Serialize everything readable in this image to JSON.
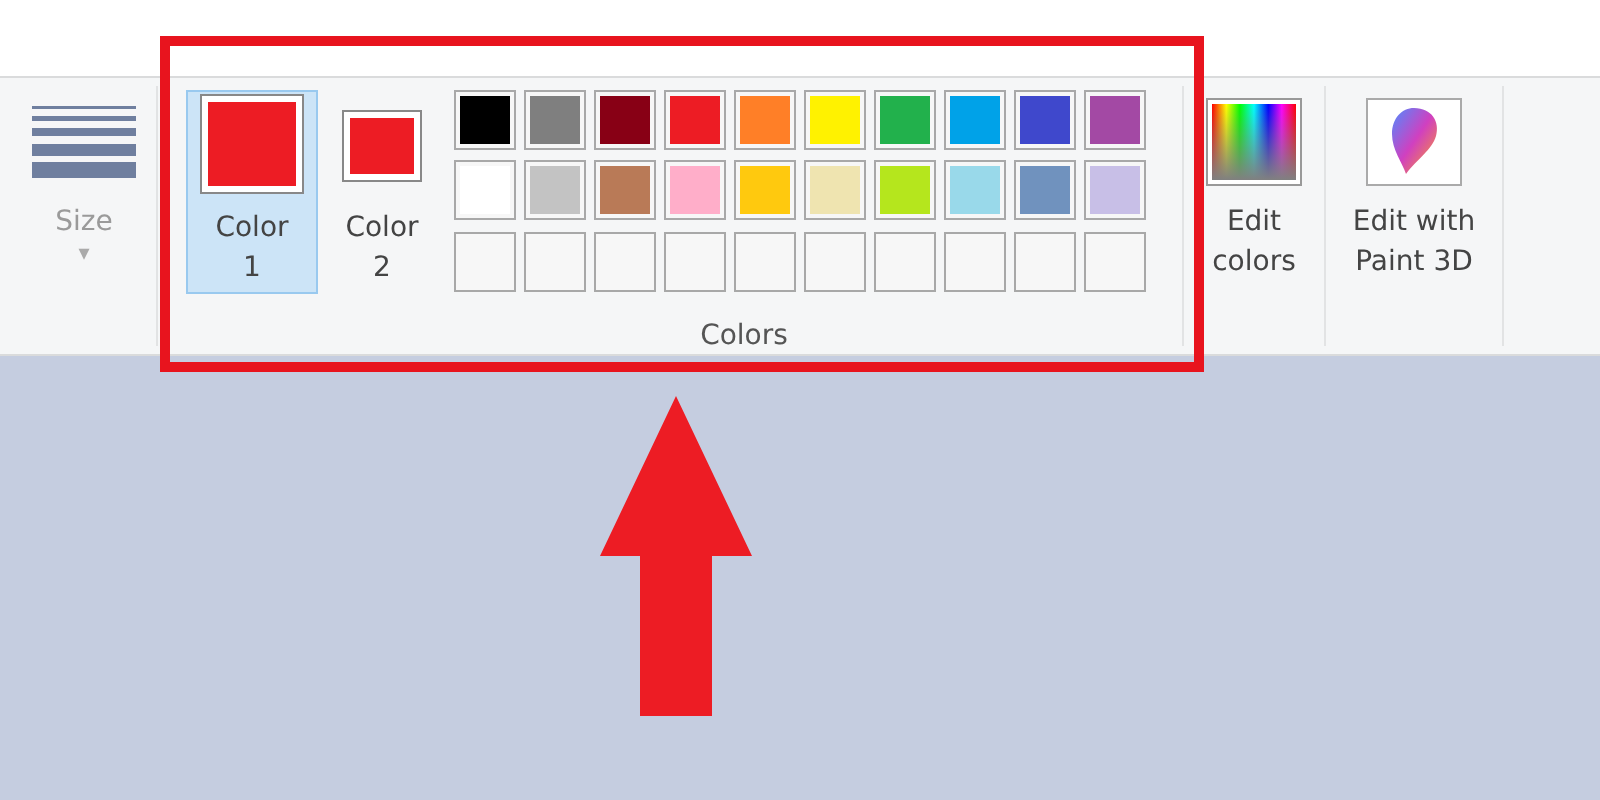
{
  "size_group": {
    "label": "Size",
    "caret": "▾"
  },
  "colors_group": {
    "label": "Colors",
    "color_buttons": [
      {
        "label": "Color",
        "number": "1",
        "color": "#ed1c24",
        "selected": true
      },
      {
        "label": "Color",
        "number": "2",
        "color": "#ed1c24",
        "selected": false
      }
    ],
    "palette": [
      {
        "kind": "swatch",
        "color": "#000000"
      },
      {
        "kind": "swatch",
        "color": "#7f7f7f"
      },
      {
        "kind": "swatch",
        "color": "#880015"
      },
      {
        "kind": "swatch",
        "color": "#ed1c24"
      },
      {
        "kind": "swatch",
        "color": "#ff7f27"
      },
      {
        "kind": "swatch",
        "color": "#fff200"
      },
      {
        "kind": "swatch",
        "color": "#22b14c"
      },
      {
        "kind": "swatch",
        "color": "#00a2e8"
      },
      {
        "kind": "swatch",
        "color": "#3f48cc"
      },
      {
        "kind": "swatch",
        "color": "#a349a4"
      },
      {
        "kind": "swatch",
        "color": "#ffffff"
      },
      {
        "kind": "swatch",
        "color": "#c3c3c3"
      },
      {
        "kind": "swatch",
        "color": "#b97a57"
      },
      {
        "kind": "swatch",
        "color": "#ffaec9"
      },
      {
        "kind": "swatch",
        "color": "#ffc90e"
      },
      {
        "kind": "swatch",
        "color": "#efe4b0"
      },
      {
        "kind": "swatch",
        "color": "#b5e61d"
      },
      {
        "kind": "swatch",
        "color": "#99d9ea"
      },
      {
        "kind": "swatch",
        "color": "#7092be"
      },
      {
        "kind": "swatch",
        "color": "#c8bfe7"
      },
      {
        "kind": "empty"
      },
      {
        "kind": "empty"
      },
      {
        "kind": "empty"
      },
      {
        "kind": "empty"
      },
      {
        "kind": "empty"
      },
      {
        "kind": "empty"
      },
      {
        "kind": "empty"
      },
      {
        "kind": "empty"
      },
      {
        "kind": "empty"
      },
      {
        "kind": "empty"
      }
    ]
  },
  "edit_colors": {
    "label": "Edit colors"
  },
  "edit_paint3d": {
    "label": "Edit with Paint 3D"
  }
}
